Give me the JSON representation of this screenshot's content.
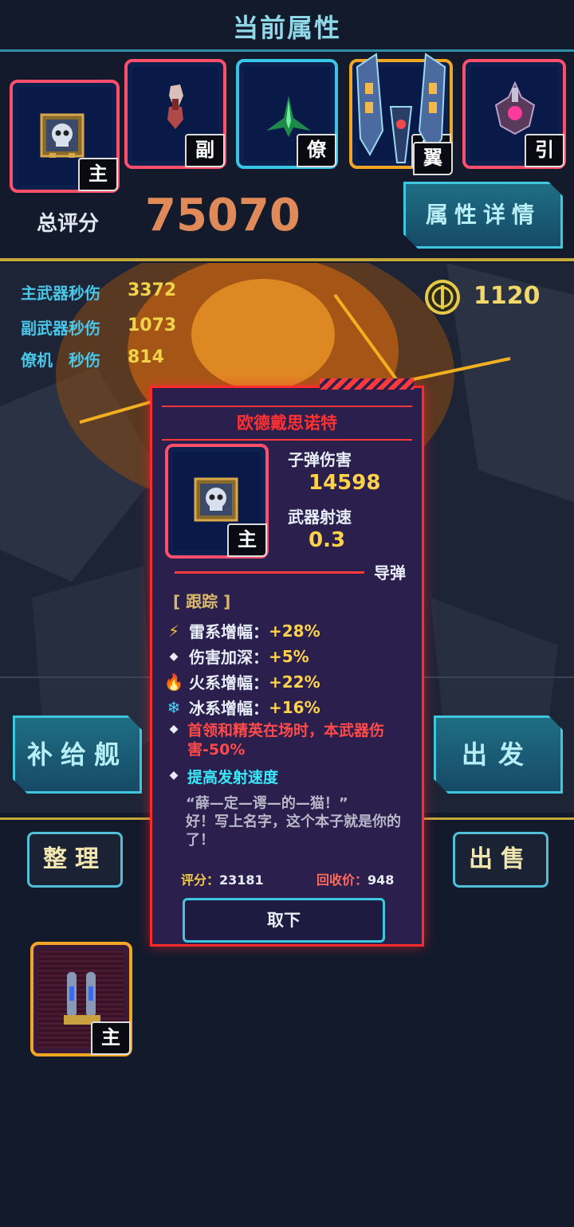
{
  "header": {
    "title": "当前属性"
  },
  "slots": [
    {
      "tag": "主",
      "item": "skull-badge",
      "border": "#ff4f6a"
    },
    {
      "tag": "副",
      "item": "fist-weapon",
      "border": "#ff4f6a"
    },
    {
      "tag": "僚",
      "item": "green-wingman",
      "border": "#39c6e6"
    },
    {
      "tag": "翼",
      "item": "blue-wing-ship",
      "border": "#f2a623"
    },
    {
      "tag": "引",
      "item": "purple-engine",
      "border": "#ff4f6a"
    }
  ],
  "score": {
    "label": "总评分",
    "value": "75070"
  },
  "attr_detail_button": "属性详情",
  "stats": [
    {
      "label": "主武器秒伤",
      "value": "3372"
    },
    {
      "label": "副武器秒伤",
      "value": "1073"
    },
    {
      "label": "僚机　秒伤",
      "value": "814"
    }
  ],
  "coins": {
    "value": "1120",
    "icon": "coin-icon"
  },
  "left_buttons": {
    "supply": "补给舰",
    "sort": "整理"
  },
  "right_buttons": {
    "depart": "出发",
    "sell": "出售"
  },
  "inventory": [
    {
      "tag": "主",
      "item": "twin-missile-pod",
      "border": "#f2a623"
    }
  ],
  "popup": {
    "name": "欧德戴思诺特",
    "item_tag": "主",
    "bullet_damage_label": "子弹伤害",
    "bullet_damage_value": "14598",
    "fire_rate_label": "武器射速",
    "fire_rate_value": "0.3",
    "weapon_type": "导弹",
    "trait": "[ 跟踪 ]",
    "bonuses": [
      {
        "icon": "lightning-icon",
        "label": "雷系增幅：",
        "value": "+28%"
      },
      {
        "icon": "diamond-icon",
        "label": "伤害加深：",
        "value": "+5%"
      },
      {
        "icon": "fire-icon",
        "label": "火系增幅：",
        "value": "+22%"
      },
      {
        "icon": "snowflake-icon",
        "label": "冰系增幅：",
        "value": "+16%"
      }
    ],
    "penalty": "首领和精英在场时，本武器伤害-50%",
    "special": "提高发射速度",
    "flavor_line1": "“薛—定—谔—的—猫！”",
    "flavor_line2": "好！写上名字，这个本子就是你的了！",
    "rating_label": "评分：",
    "rating_value": "23181",
    "recycle_label": "回收价：",
    "recycle_value": "948",
    "unequip_button": "取下"
  },
  "colors": {
    "accent": "#3ec8e0",
    "score": "#e08a5a",
    "popup_border": "#ff2a2a",
    "gold": "#ffd24a"
  }
}
